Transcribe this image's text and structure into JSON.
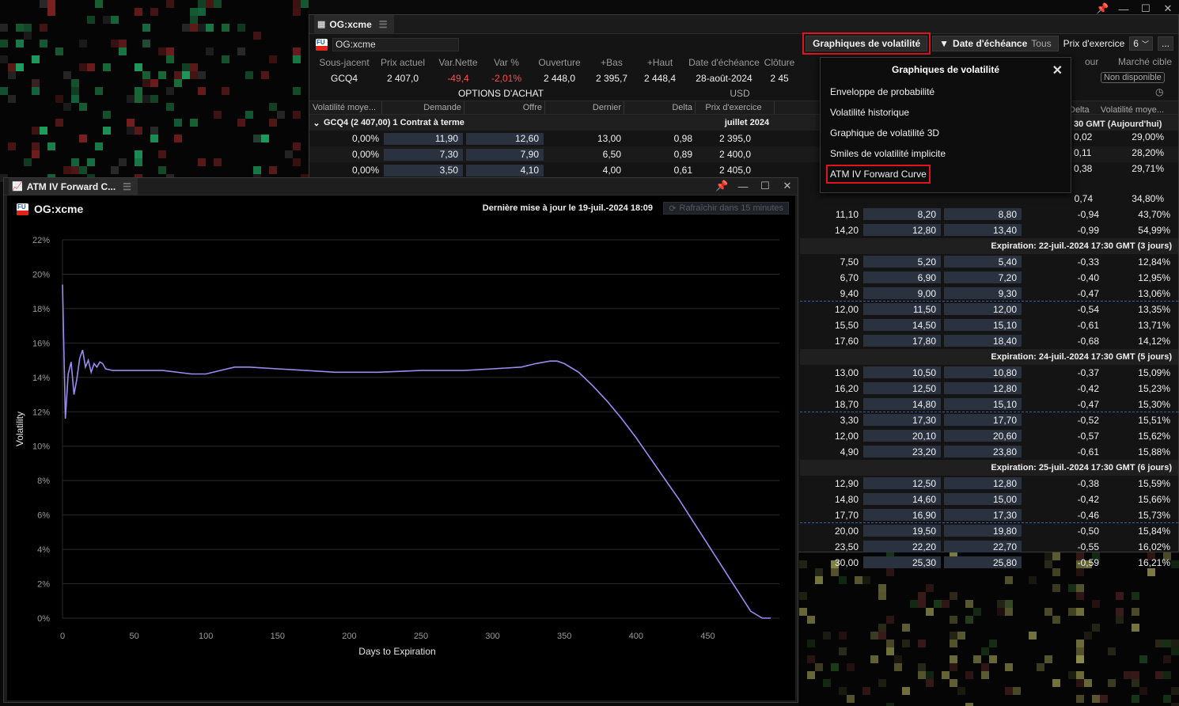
{
  "options_window": {
    "title": "OG:xcme",
    "symbol_input": "OG:xcme",
    "toolbar": {
      "vol_charts_label": "Graphiques de volatilité",
      "expiry_label": "Date d'échéance",
      "expiry_value": "Tous",
      "strike_label": "Prix d'exercice",
      "strike_value": "6",
      "more": "..."
    },
    "underlying_headers": [
      "Sous-jacent",
      "Prix actuel",
      "Var.Nette",
      "Var %",
      "Ouverture",
      "+Bas",
      "+Haut",
      "Date d'échéance",
      "Clôture"
    ],
    "underlying_values": [
      "GCQ4",
      "2 407,0",
      "-49,4",
      "-2,01%",
      "2 448,0",
      "2 395,7",
      "2 448,4",
      "28-août-2024",
      "2 45"
    ],
    "right_headers": [
      "our",
      "Marché cible"
    ],
    "non_dispo": "Non disponible",
    "calls_title": "OPTIONS D'ACHAT",
    "currency": "USD",
    "col_headers": [
      "Volatilité moye...",
      "Demande",
      "Offre",
      "Dernier",
      "Delta",
      "Prix d'exercice"
    ],
    "right_col_headers": [
      "Delta",
      "Volatilité moye..."
    ],
    "group_label": "GCQ4  (2 407,00)  1 Contrat à terme",
    "group_month": "juillet 2024",
    "group_right": "30 GMT (Aujourd'hui)",
    "rows": [
      {
        "vol": "0,00%",
        "bid": "11,90",
        "ask": "12,60",
        "last": "13,00",
        "delta": "0,98",
        "strike": "2 395,0",
        "rdelta": "0,02",
        "rvol": "29,00%"
      },
      {
        "vol": "0,00%",
        "bid": "7,30",
        "ask": "7,90",
        "last": "6,50",
        "delta": "0,89",
        "strike": "2 400,0",
        "rdelta": "0,11",
        "rvol": "28,20%"
      },
      {
        "vol": "0,00%",
        "bid": "3,50",
        "ask": "4,10",
        "last": "4,00",
        "delta": "0,61",
        "strike": "2 405,0",
        "rdelta": "0,38",
        "rvol": "29,71%"
      }
    ],
    "right_rows": [
      {
        "type": "row",
        "a": "",
        "b": "",
        "c": "",
        "d": "0,74",
        "e": "34,80%",
        "dash": false
      },
      {
        "type": "row",
        "a": "11,10",
        "b": "8,20",
        "c": "8,80",
        "d": "-0,94",
        "e": "43,70%",
        "dash": false
      },
      {
        "type": "row",
        "a": "14,20",
        "b": "12,80",
        "c": "13,40",
        "d": "-0,99",
        "e": "54,99%",
        "dash": false
      },
      {
        "type": "exp",
        "label": "Expiration: 22-juil.-2024 17:30 GMT (3 jours)"
      },
      {
        "type": "row",
        "a": "7,50",
        "b": "5,20",
        "c": "5,40",
        "d": "-0,33",
        "e": "12,84%",
        "dash": false
      },
      {
        "type": "row",
        "a": "6,70",
        "b": "6,90",
        "c": "7,20",
        "d": "-0,40",
        "e": "12,95%",
        "dash": false
      },
      {
        "type": "row",
        "a": "9,40",
        "b": "9,00",
        "c": "9,30",
        "d": "-0,47",
        "e": "13,06%",
        "dash": true
      },
      {
        "type": "row",
        "a": "12,00",
        "b": "11,50",
        "c": "12,00",
        "d": "-0,54",
        "e": "13,35%",
        "dash": false
      },
      {
        "type": "row",
        "a": "15,50",
        "b": "14,50",
        "c": "15,10",
        "d": "-0,61",
        "e": "13,71%",
        "dash": false
      },
      {
        "type": "row",
        "a": "17,60",
        "b": "17,80",
        "c": "18,40",
        "d": "-0,68",
        "e": "14,12%",
        "dash": false
      },
      {
        "type": "exp",
        "label": "Expiration: 24-juil.-2024 17:30 GMT (5 jours)"
      },
      {
        "type": "row",
        "a": "13,00",
        "b": "10,50",
        "c": "10,80",
        "d": "-0,37",
        "e": "15,09%",
        "dash": false
      },
      {
        "type": "row",
        "a": "16,20",
        "b": "12,50",
        "c": "12,80",
        "d": "-0,42",
        "e": "15,23%",
        "dash": false
      },
      {
        "type": "row",
        "a": "18,70",
        "b": "14,80",
        "c": "15,10",
        "d": "-0,47",
        "e": "15,30%",
        "dash": true
      },
      {
        "type": "row",
        "a": "3,30",
        "b": "17,30",
        "c": "17,70",
        "d": "-0,52",
        "e": "15,51%",
        "dash": false
      },
      {
        "type": "row",
        "a": "12,00",
        "b": "20,10",
        "c": "20,60",
        "d": "-0,57",
        "e": "15,62%",
        "dash": false
      },
      {
        "type": "row",
        "a": "4,90",
        "b": "23,20",
        "c": "23,80",
        "d": "-0,61",
        "e": "15,88%",
        "dash": false
      },
      {
        "type": "exp",
        "label": "Expiration: 25-juil.-2024 17:30 GMT (6 jours)"
      },
      {
        "type": "row",
        "a": "12,90",
        "b": "12,50",
        "c": "12,80",
        "d": "-0,38",
        "e": "15,59%",
        "dash": false
      },
      {
        "type": "row",
        "a": "14,80",
        "b": "14,60",
        "c": "15,00",
        "d": "-0,42",
        "e": "15,66%",
        "dash": false
      },
      {
        "type": "row",
        "a": "17,70",
        "b": "16,90",
        "c": "17,30",
        "d": "-0,46",
        "e": "15,73%",
        "dash": true
      },
      {
        "type": "row",
        "a": "20,00",
        "b": "19,50",
        "c": "19,80",
        "d": "-0,50",
        "e": "15,84%",
        "dash": false
      },
      {
        "type": "row",
        "a": "23,50",
        "b": "22,20",
        "c": "22,70",
        "d": "-0,55",
        "e": "16,02%",
        "dash": false
      },
      {
        "type": "row",
        "a": "30,00",
        "b": "25,30",
        "c": "25,80",
        "d": "-0,59",
        "e": "16,21%",
        "dash": false
      }
    ]
  },
  "dropdown": {
    "title": "Graphiques de volatilité",
    "items": [
      "Enveloppe de probabilité",
      "Volatilité historique",
      "Graphique de volatilité 3D",
      "Smiles de volatilité implicite",
      "ATM IV Forward Curve"
    ]
  },
  "chart_window": {
    "title": "ATM IV Forward C...",
    "symbol": "OG:xcme",
    "last_update": "Dernière mise à jour le 19-juil.-2024 18:09",
    "refresh": "Rafraîchir dans 15 minutes"
  },
  "colors": {
    "line": "#9b8cf0",
    "accent_red": "#e0141d",
    "neg": "#ff4b4b"
  },
  "chart_data": {
    "type": "line",
    "title": "",
    "xlabel": "Days to Expiration",
    "ylabel": "Volatility",
    "xlim": [
      0,
      500
    ],
    "ylim": [
      0,
      22
    ],
    "x_ticks": [
      0,
      50,
      100,
      150,
      200,
      250,
      300,
      350,
      400,
      450
    ],
    "y_ticks": [
      "0%",
      "2%",
      "4%",
      "6%",
      "8%",
      "10%",
      "12%",
      "14%",
      "16%",
      "18%",
      "20%",
      "22%"
    ],
    "series": [
      {
        "x": [
          0,
          2,
          4,
          6,
          8,
          10,
          12,
          14,
          16,
          18,
          20,
          22,
          24,
          26,
          28,
          30,
          35,
          40,
          50,
          70,
          90,
          100,
          110,
          120,
          130,
          150,
          170,
          190,
          200,
          220,
          250,
          280,
          300,
          320,
          330,
          340,
          345,
          350,
          360,
          370,
          380,
          390,
          400,
          410,
          420,
          430,
          440,
          450,
          460,
          470,
          480,
          488,
          494
        ],
        "y": [
          19.4,
          11.6,
          14.2,
          14.9,
          13.0,
          13.9,
          15.1,
          15.6,
          14.6,
          15.0,
          14.3,
          14.8,
          14.6,
          14.9,
          14.8,
          14.5,
          14.4,
          14.4,
          14.4,
          14.4,
          14.2,
          14.2,
          14.4,
          14.6,
          14.6,
          14.5,
          14.4,
          14.3,
          14.3,
          14.3,
          14.4,
          14.4,
          14.5,
          14.6,
          14.8,
          14.95,
          14.95,
          14.8,
          14.3,
          13.5,
          12.6,
          11.6,
          10.5,
          9.3,
          8.1,
          6.9,
          5.6,
          4.3,
          3.0,
          1.7,
          0.4,
          0,
          0
        ]
      }
    ]
  }
}
